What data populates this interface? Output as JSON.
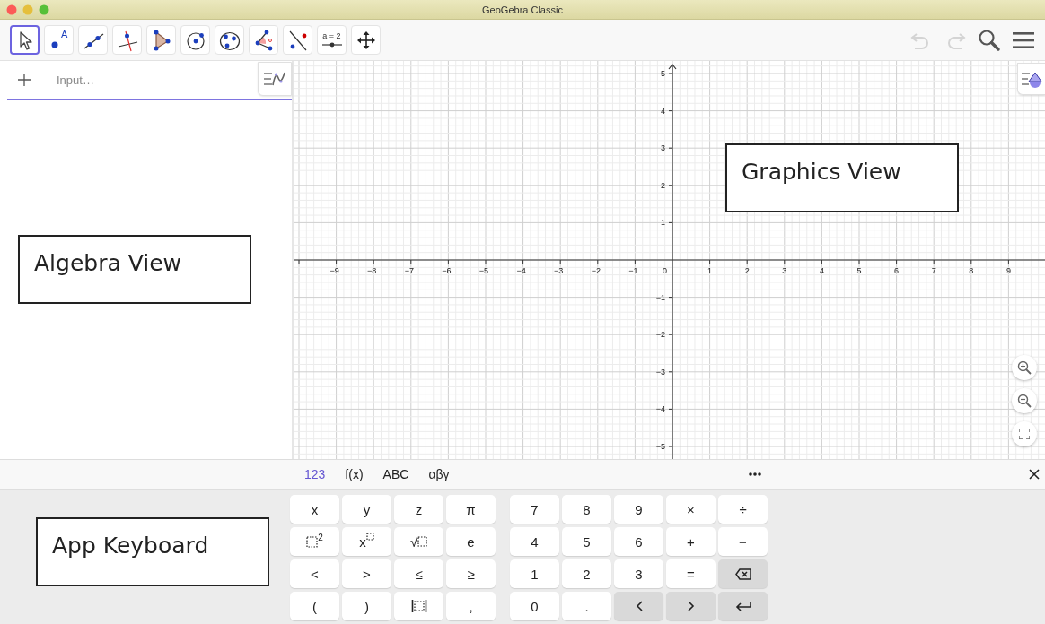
{
  "window": {
    "title": "GeoGebra Classic"
  },
  "toolbar": {
    "tools": [
      {
        "kind": "move",
        "selected": true
      },
      {
        "kind": "point",
        "label": "A",
        "selected": false
      },
      {
        "kind": "line",
        "selected": false
      },
      {
        "kind": "perpendicular",
        "selected": false
      },
      {
        "kind": "polygon",
        "selected": false
      },
      {
        "kind": "circle",
        "selected": false
      },
      {
        "kind": "circle3",
        "selected": false
      },
      {
        "kind": "angle",
        "selected": false
      },
      {
        "kind": "reflect",
        "selected": false
      },
      {
        "kind": "slider",
        "label": "a = 2",
        "selected": false
      },
      {
        "kind": "move_view",
        "selected": false
      }
    ],
    "actions": [
      {
        "kind": "undo",
        "disabled": true
      },
      {
        "kind": "redo",
        "disabled": true
      },
      {
        "kind": "search",
        "disabled": false
      },
      {
        "kind": "menu",
        "disabled": false
      }
    ]
  },
  "algebra_view": {
    "input": {
      "placeholder": "Input…"
    },
    "annotation": "Algebra View"
  },
  "graphics_view": {
    "annotation": "Graphics View",
    "origin_label": "0",
    "x_labels": [
      "−9",
      "−8",
      "−7",
      "−6",
      "−5",
      "−4",
      "−3",
      "−2",
      "−1",
      "1",
      "2",
      "3",
      "4",
      "5",
      "6",
      "7",
      "8",
      "9"
    ],
    "y_labels": [
      "5",
      "4",
      "3",
      "2",
      "1",
      "−1",
      "−2",
      "−3",
      "−4",
      "−5"
    ]
  },
  "keyboard": {
    "annotation": "App Keyboard",
    "tabs": [
      {
        "label": "123",
        "selected": true
      },
      {
        "label": "f(x)",
        "selected": false
      },
      {
        "label": "ABC",
        "selected": false
      },
      {
        "label": "αβγ",
        "selected": false
      }
    ],
    "left_keys": [
      [
        {
          "kind": "char",
          "label": "x"
        },
        {
          "kind": "char",
          "label": "y"
        },
        {
          "kind": "char",
          "label": "z"
        },
        {
          "kind": "char",
          "label": "π"
        }
      ],
      [
        {
          "kind": "power",
          "label": "2"
        },
        {
          "kind": "power_base",
          "label": "x"
        },
        {
          "kind": "sqrt",
          "label": "√"
        },
        {
          "kind": "char",
          "label": "e"
        }
      ],
      [
        {
          "kind": "char",
          "label": "<"
        },
        {
          "kind": "char",
          "label": ">"
        },
        {
          "kind": "char",
          "label": "≤"
        },
        {
          "kind": "char",
          "label": "≥"
        }
      ],
      [
        {
          "kind": "char",
          "label": "("
        },
        {
          "kind": "char",
          "label": ")"
        },
        {
          "kind": "abs"
        },
        {
          "kind": "char",
          "label": ","
        }
      ]
    ],
    "right_keys": [
      [
        {
          "kind": "char",
          "label": "7"
        },
        {
          "kind": "char",
          "label": "8"
        },
        {
          "kind": "char",
          "label": "9"
        },
        {
          "kind": "char",
          "label": "×"
        },
        {
          "kind": "char",
          "label": "÷"
        }
      ],
      [
        {
          "kind": "char",
          "label": "4"
        },
        {
          "kind": "char",
          "label": "5"
        },
        {
          "kind": "char",
          "label": "6"
        },
        {
          "kind": "char",
          "label": "+"
        },
        {
          "kind": "char",
          "label": "−"
        }
      ],
      [
        {
          "kind": "char",
          "label": "1"
        },
        {
          "kind": "char",
          "label": "2"
        },
        {
          "kind": "char",
          "label": "3"
        },
        {
          "kind": "char",
          "label": "="
        },
        {
          "kind": "backspace"
        }
      ],
      [
        {
          "kind": "char",
          "label": "0"
        },
        {
          "kind": "char",
          "label": "."
        },
        {
          "kind": "left"
        },
        {
          "kind": "right"
        },
        {
          "kind": "enter"
        }
      ]
    ]
  }
}
